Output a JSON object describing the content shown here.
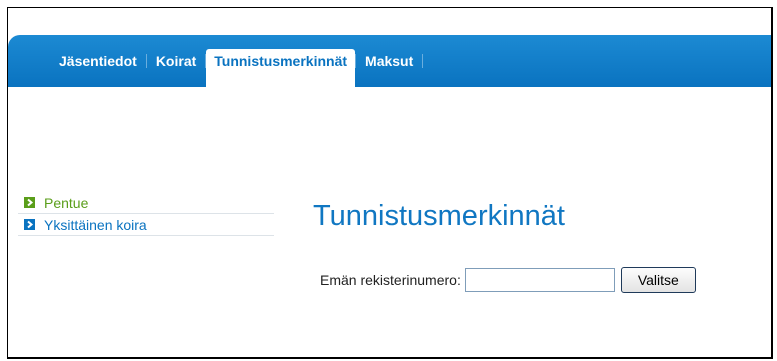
{
  "nav": {
    "tabs": [
      {
        "label": "Jäsentiedot"
      },
      {
        "label": "Koirat"
      },
      {
        "label": "Tunnistusmerkinnät",
        "active": true
      },
      {
        "label": "Maksut"
      }
    ],
    "bar_color": "#0a73c0"
  },
  "sidebar": {
    "items": [
      {
        "label": "Pentue",
        "color": "#5a9e1a",
        "icon": "arrow-right-icon"
      },
      {
        "label": "Yksittäinen koira",
        "color": "#0a73c0",
        "icon": "arrow-right-icon"
      }
    ]
  },
  "main": {
    "title": "Tunnistusmerkinnät",
    "form": {
      "label": "Emän rekisterinumero:",
      "input_value": "",
      "button_label": "Valitse"
    }
  }
}
